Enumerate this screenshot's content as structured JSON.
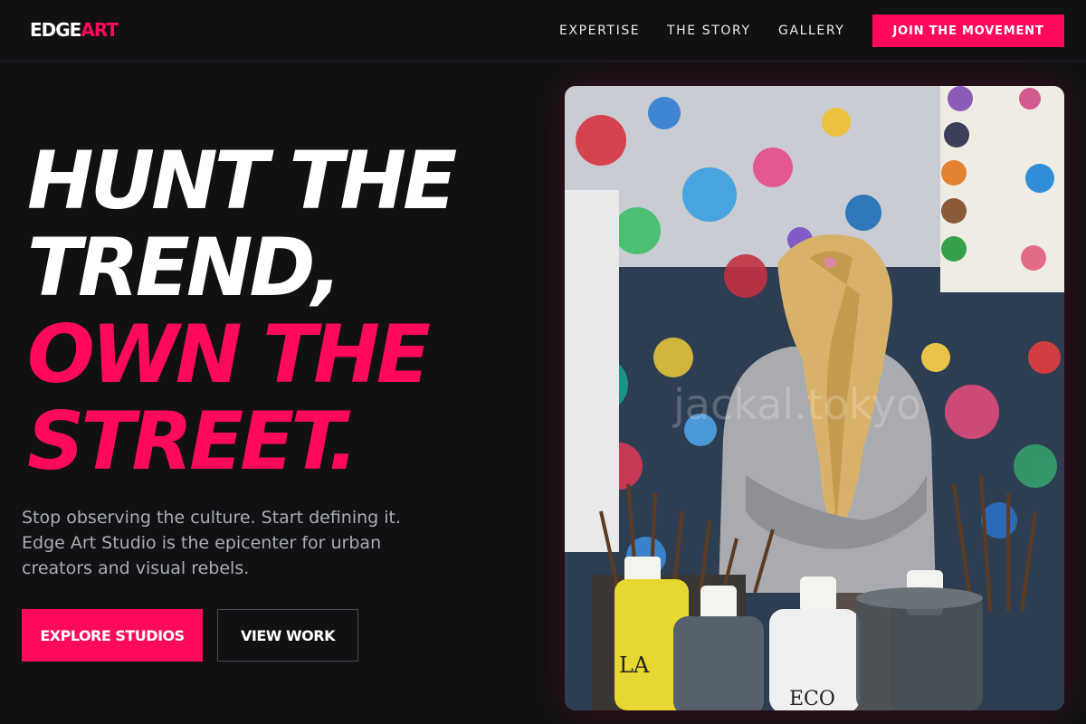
{
  "logo": {
    "part1": "EDGE",
    "part2": "ART"
  },
  "nav": {
    "links": [
      "EXPERTISE",
      "THE STORY",
      "GALLERY"
    ],
    "cta": "JOIN THE MOVEMENT"
  },
  "hero": {
    "headline": {
      "line1": "HUNT THE",
      "line2": "TREND,",
      "line3": "OWN THE",
      "line4": "STREET."
    },
    "subtext": "Stop observing the culture. Start defining it. Edge Art Studio is the epicenter for urban creators and visual rebels.",
    "primary_button": "EXPLORE STUDIOS",
    "secondary_button": "VIEW WORK",
    "image": {
      "watermark": "jackal.tokyo",
      "bottle_label_1": "LA",
      "bottle_label_2": "ECO"
    }
  },
  "colors": {
    "accent": "#ff0a5a",
    "background": "#111113",
    "muted_text": "#a8adb8"
  }
}
